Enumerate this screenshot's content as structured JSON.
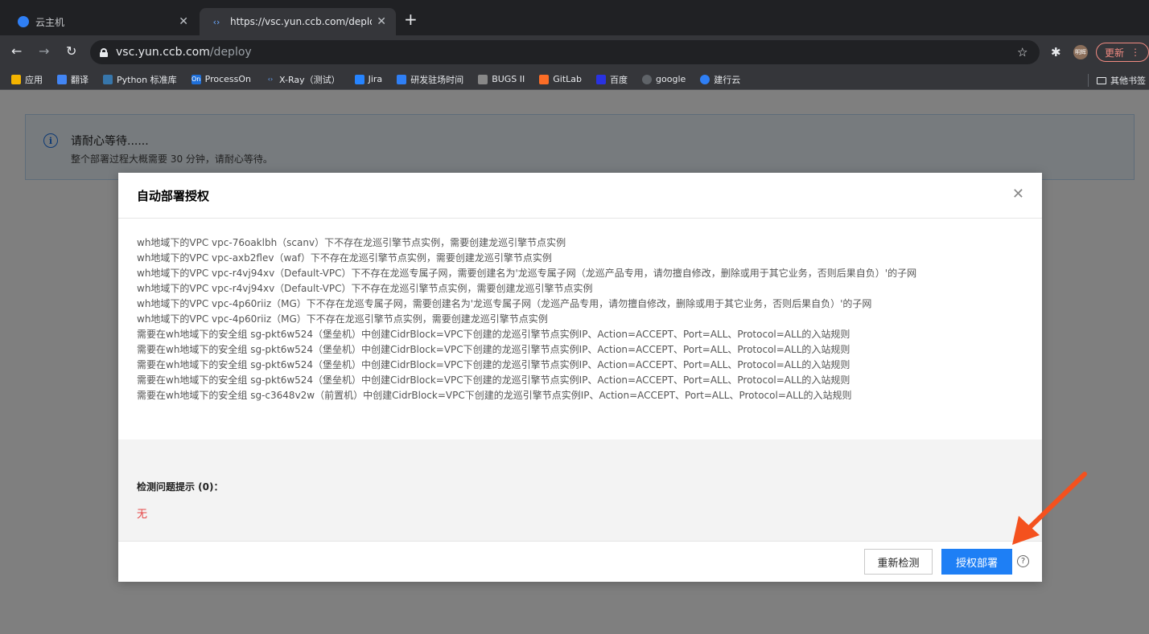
{
  "browser": {
    "tabs": [
      {
        "title": "云主机",
        "icon": "cloud-icon"
      },
      {
        "title": "https://vsc.yun.ccb.com/deploy",
        "icon": "code-icon"
      }
    ],
    "url": {
      "host": "vsc.yun.ccb.com",
      "path": "/deploy"
    },
    "avatar_text": "明辉",
    "update_label": "更新",
    "bookmarks": [
      {
        "label": "应用",
        "color": "#f4b400"
      },
      {
        "label": "翻译",
        "color": "#4285f4"
      },
      {
        "label": "Python 标准库",
        "color": "#3776ab"
      },
      {
        "label": "ProcessOn",
        "color": "#1e6fd9"
      },
      {
        "label": "X-Ray（测试）",
        "color": "#6aa9ff"
      },
      {
        "label": "Jira",
        "color": "#2684ff"
      },
      {
        "label": "研发驻场时间",
        "color": "#2f7ff5"
      },
      {
        "label": "BUGS II",
        "color": "#888888"
      },
      {
        "label": "GitLab",
        "color": "#fc6d26"
      },
      {
        "label": "百度",
        "color": "#2932e1"
      },
      {
        "label": "google",
        "color": "#5f6368"
      },
      {
        "label": "建行云",
        "color": "#2f7ff5"
      }
    ],
    "other_bookmarks": "其他书签"
  },
  "alert": {
    "title": "请耐心等待......",
    "desc": "整个部署过程大概需要 30 分钟，请耐心等待。"
  },
  "modal": {
    "title": "自动部署授权",
    "messages": [
      "wh地域下的VPC vpc-76oaklbh（scanv）下不存在龙巡引擎节点实例，需要创建龙巡引擎节点实例",
      "wh地域下的VPC vpc-axb2flev（waf）下不存在龙巡引擎节点实例，需要创建龙巡引擎节点实例",
      "wh地域下的VPC vpc-r4vj94xv（Default-VPC）下不存在龙巡专属子网，需要创建名为'龙巡专属子网（龙巡产品专用，请勿擅自修改，删除或用于其它业务，否则后果自负）'的子网",
      "wh地域下的VPC vpc-r4vj94xv（Default-VPC）下不存在龙巡引擎节点实例，需要创建龙巡引擎节点实例",
      "wh地域下的VPC vpc-4p60riiz（MG）下不存在龙巡专属子网，需要创建名为'龙巡专属子网（龙巡产品专用，请勿擅自修改，删除或用于其它业务，否则后果自负）'的子网",
      "wh地域下的VPC vpc-4p60riiz（MG）下不存在龙巡引擎节点实例，需要创建龙巡引擎节点实例",
      "需要在wh地域下的安全组 sg-pkt6w524（堡垒机）中创建CidrBlock=VPC下创建的龙巡引擎节点实例IP、Action=ACCEPT、Port=ALL、Protocol=ALL的入站规则",
      "需要在wh地域下的安全组 sg-pkt6w524（堡垒机）中创建CidrBlock=VPC下创建的龙巡引擎节点实例IP、Action=ACCEPT、Port=ALL、Protocol=ALL的入站规则",
      "需要在wh地域下的安全组 sg-pkt6w524（堡垒机）中创建CidrBlock=VPC下创建的龙巡引擎节点实例IP、Action=ACCEPT、Port=ALL、Protocol=ALL的入站规则",
      "需要在wh地域下的安全组 sg-pkt6w524（堡垒机）中创建CidrBlock=VPC下创建的龙巡引擎节点实例IP、Action=ACCEPT、Port=ALL、Protocol=ALL的入站规则",
      "需要在wh地域下的安全组 sg-c3648v2w（前置机）中创建CidrBlock=VPC下创建的龙巡引擎节点实例IP、Action=ACCEPT、Port=ALL、Protocol=ALL的入站规则"
    ],
    "check_title": "检测问题提示 (0)：",
    "check_result": "无",
    "recheck_label": "重新检测",
    "authorize_label": "授权部署",
    "help_glyph": "?"
  },
  "colors": {
    "primary": "#1e7ff5",
    "error": "#e54545",
    "annotation_arrow": "#f4511e"
  }
}
